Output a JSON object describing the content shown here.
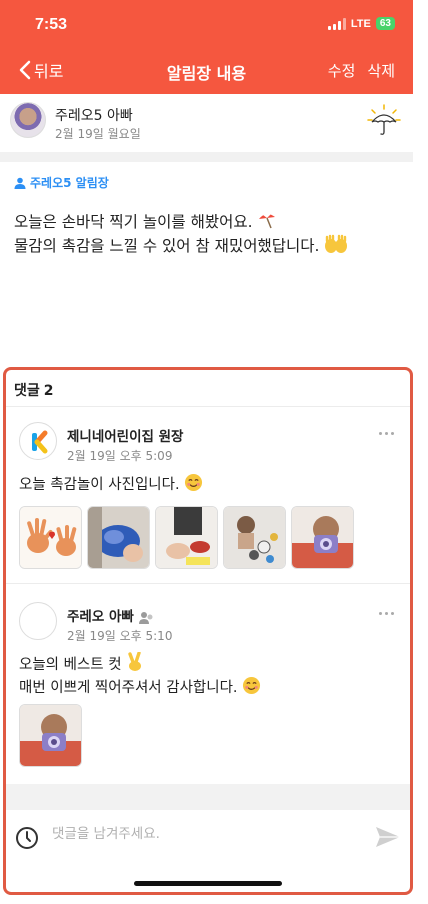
{
  "status": {
    "time": "7:53",
    "network": "LTE",
    "battery": "63"
  },
  "nav": {
    "back_label": "뒤로",
    "title": "알림장 내용",
    "edit_label": "수정",
    "delete_label": "삭제"
  },
  "author": {
    "name": "주레오5 아빠",
    "date": "2월 19일 월요일",
    "weather_icon": "umbrella-weather-icon"
  },
  "notice": {
    "tag": "주레오5 알림장",
    "line1": "오늘은 손바닥 찍기 놀이를 해봤어요.",
    "line2": "물감의 촉감을 느낄 수 있어 참 재밌어했답니다."
  },
  "comments": {
    "label": "댓글",
    "count": "2",
    "items": [
      {
        "name": "제니네어린이집 원장",
        "date": "2월 19일 오후 5:09",
        "text": "오늘 촉감놀이 사진입니다."
      },
      {
        "name": "주레오 아빠",
        "date": "2월 19일 오후 5:10",
        "text_line1": "오늘의 베스트 컷",
        "text_line2": "매번 이쁘게 찍어주셔서 감사합니다."
      }
    ],
    "input_placeholder": "댓글을 남겨주세요."
  },
  "colors": {
    "header": "#f5573f",
    "accent_blue": "#2c8ff4",
    "highlight_border": "#e05a43"
  }
}
